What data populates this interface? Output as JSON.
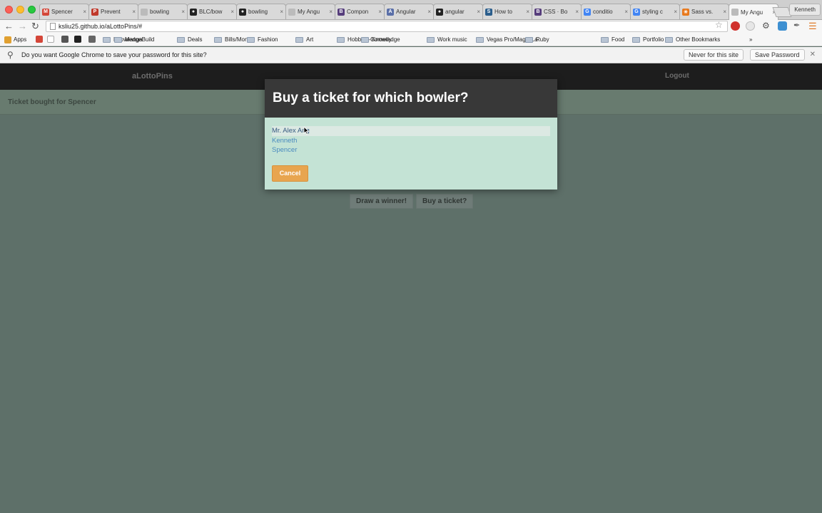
{
  "browser": {
    "tabs": [
      {
        "label": "Spencer",
        "icon": "gmail-icon",
        "color": "#d44638",
        "glyph": "M"
      },
      {
        "label": "Prevent",
        "icon": "stack-icon",
        "color": "#c0392b",
        "glyph": "P"
      },
      {
        "label": "bowling",
        "icon": "page-icon",
        "color": "#bbbbbb",
        "glyph": ""
      },
      {
        "label": "BLC/bow",
        "icon": "github-icon",
        "color": "#222222",
        "glyph": "●"
      },
      {
        "label": "bowling",
        "icon": "github-icon",
        "color": "#222222",
        "glyph": "●"
      },
      {
        "label": "My Angu",
        "icon": "page-icon",
        "color": "#bbbbbb",
        "glyph": ""
      },
      {
        "label": "Compon",
        "icon": "bootstrap-icon",
        "color": "#563d7c",
        "glyph": "B"
      },
      {
        "label": "Angular",
        "icon": "doc-icon",
        "color": "#5a6fa8",
        "glyph": "A"
      },
      {
        "label": "angular",
        "icon": "github-icon",
        "color": "#222222",
        "glyph": "●"
      },
      {
        "label": "How to",
        "icon": "site-icon",
        "color": "#2b5e8c",
        "glyph": "S"
      },
      {
        "label": "CSS · Bo",
        "icon": "bootstrap-icon",
        "color": "#563d7c",
        "glyph": "B"
      },
      {
        "label": "conditio",
        "icon": "google-icon",
        "color": "#4285f4",
        "glyph": "G"
      },
      {
        "label": "styling c",
        "icon": "google-icon",
        "color": "#4285f4",
        "glyph": "G"
      },
      {
        "label": "Sass vs.",
        "icon": "sass-icon",
        "color": "#e8791d",
        "glyph": "✳"
      },
      {
        "label": "My Angu",
        "icon": "page-icon",
        "color": "#bbbbbb",
        "glyph": "",
        "active": true
      }
    ],
    "profile": "Kenneth",
    "url": "ksliu25.github.io/aLottoPins/#",
    "bookmarks": [
      {
        "label": "Apps",
        "type": "apps"
      },
      {
        "label": "",
        "type": "gmail"
      },
      {
        "label": "",
        "type": "drag"
      },
      {
        "label": "",
        "type": "person"
      },
      {
        "label": "",
        "type": "github"
      },
      {
        "label": "",
        "type": "bm"
      },
      {
        "label": "KnowledgeBuild",
        "type": "folder"
      },
      {
        "label": "Manga",
        "type": "folder"
      },
      {
        "label": "Deals",
        "type": "folder"
      },
      {
        "label": "Bills/Money",
        "type": "folder"
      },
      {
        "label": "Fashion",
        "type": "folder"
      },
      {
        "label": "Art",
        "type": "folder"
      },
      {
        "label": "Hobbies-Comedy",
        "type": "folder"
      },
      {
        "label": "Knowledge",
        "type": "folder"
      },
      {
        "label": "Work music",
        "type": "folder"
      },
      {
        "label": "Vegas Pro/Magic La",
        "type": "folder"
      },
      {
        "label": "Ruby",
        "type": "folder"
      },
      {
        "label": "Food",
        "type": "folder"
      },
      {
        "label": "Portfolio",
        "type": "folder"
      },
      {
        "label": "Other Bookmarks",
        "type": "folder"
      }
    ],
    "infobar": {
      "message": "Do you want Google Chrome to save your password for this site?",
      "never_label": "Never for this site",
      "save_label": "Save Password"
    }
  },
  "app": {
    "brand": "aLottoPins",
    "logout_label": "Logout",
    "flash_message": "Ticket bought for Spencer",
    "draw_winner_label": "Draw a winner!",
    "buy_ticket_label": "Buy a ticket?"
  },
  "modal": {
    "title": "Buy a ticket for which bowler?",
    "bowlers": [
      "Mr. Alex Ang",
      "Kenneth",
      "Spencer"
    ],
    "cancel_label": "Cancel",
    "accent_color": "#e8a54f"
  }
}
